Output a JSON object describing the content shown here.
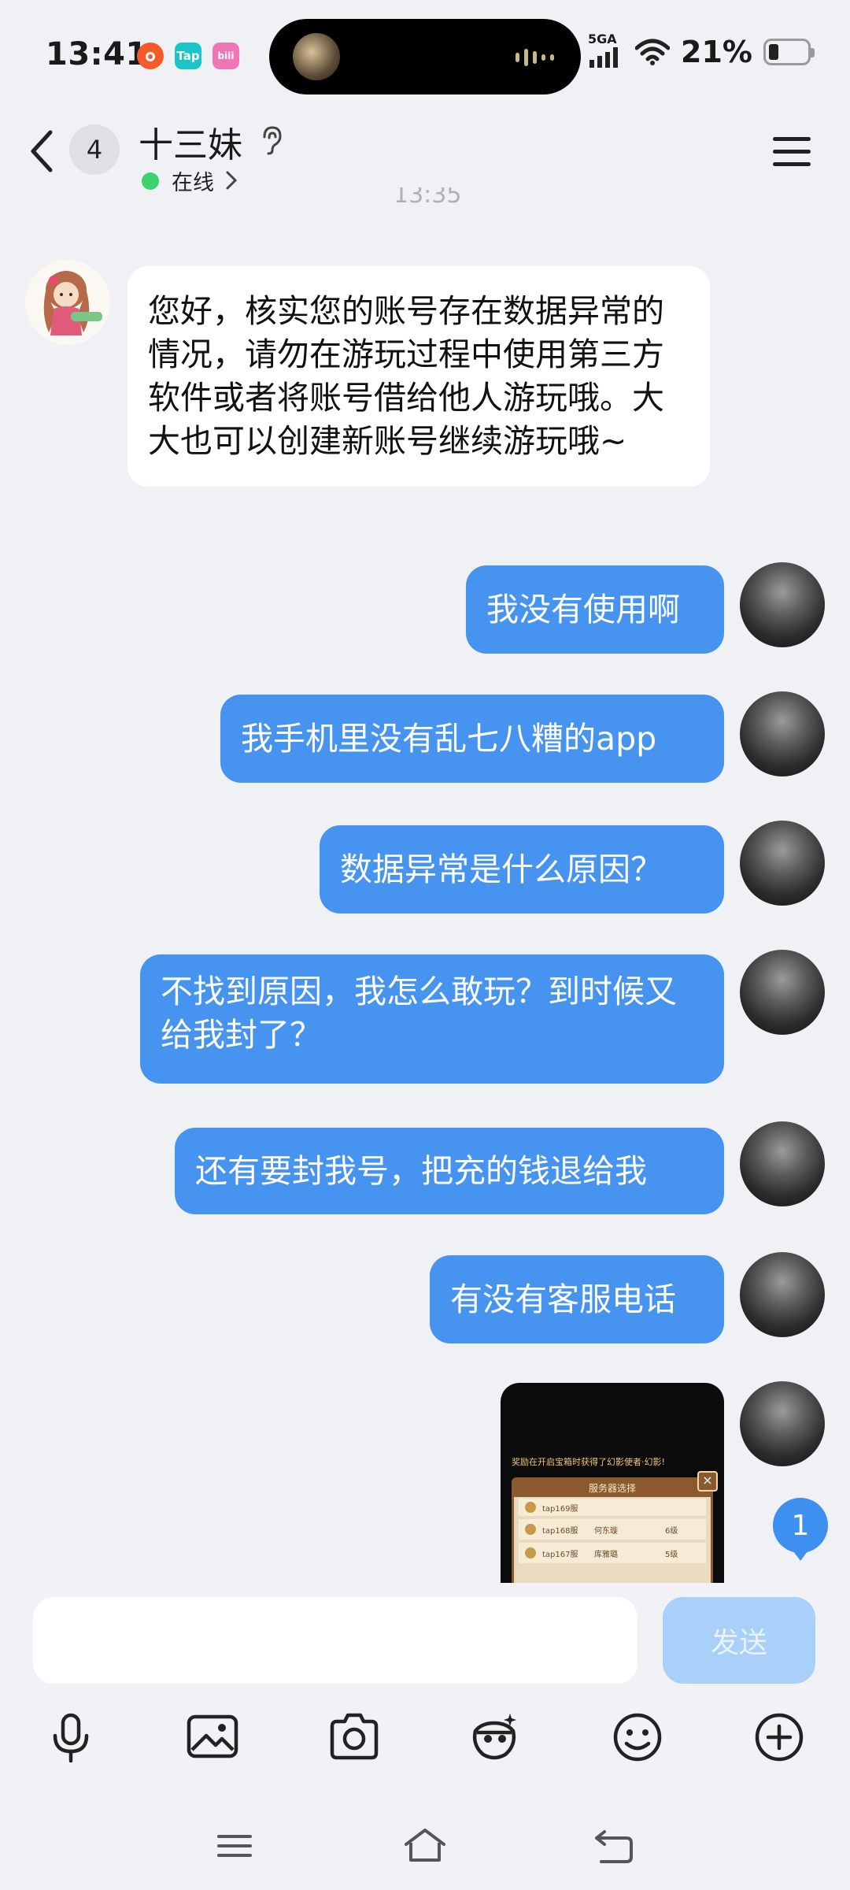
{
  "status_bar": {
    "time": "13:41",
    "network": "5GA",
    "battery": "21%",
    "notifications": [
      {
        "icon": "weibo-app-icon",
        "color": "#f55a2b",
        "label": ""
      },
      {
        "icon": "taptap-app-icon",
        "color": "#19c5c8",
        "label": "Tap"
      },
      {
        "icon": "bilibili-app-icon",
        "color": "#f075b5",
        "label": "bili"
      }
    ]
  },
  "header": {
    "unread_count": "4",
    "contact_name": "十三妹",
    "presence": "在线"
  },
  "timestamp": "13:35",
  "messages": {
    "incoming_1": "您好，核实您的账号存在数据异常的情况，请勿在游玩过程中使用第三方软件或者将账号借给他人游玩哦。大大也可以创建新账号继续游玩哦~",
    "outgoing_1": "我没有使用啊",
    "outgoing_2": "我手机里没有乱七八糟的app",
    "outgoing_3": "数据异常是什么原因？",
    "outgoing_4": "不找到原因，我怎么敢玩？到时候又给我封了？",
    "outgoing_5": "还有要封我号，把充的钱退给我",
    "outgoing_6": "有没有客服电话"
  },
  "image_message": {
    "banner": "奖励在开启宝箱时获得了幻影使者·幻影!",
    "panel_title": "服务器选择",
    "rows": [
      {
        "server": "tap169服",
        "name": "",
        "level": ""
      },
      {
        "server": "tap168服",
        "name": "何东璇",
        "level": "6级"
      },
      {
        "server": "tap167服",
        "name": "库雅璐",
        "level": "5级"
      }
    ]
  },
  "scroll_badge": "1",
  "composer": {
    "placeholder": "",
    "send_label": "发送"
  },
  "colors": {
    "bubble_out": "#4693f0",
    "online": "#3cd36c",
    "send_disabled": "#a8d0f8"
  }
}
